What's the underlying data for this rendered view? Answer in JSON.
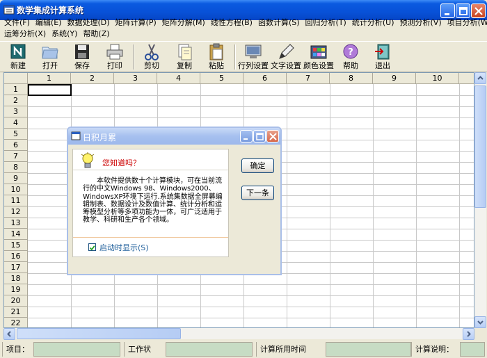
{
  "window": {
    "title": "数学集成计算系统"
  },
  "menu": {
    "row1": [
      "文件(F)",
      "编辑(E)",
      "数据处理(D)",
      "矩阵计算(P)",
      "矩阵分解(M)",
      "线性方程(B)",
      "函数计算(S)",
      "回归分析(T)",
      "统计分析(U)",
      "预测分析(V)",
      "项目分析(W)"
    ],
    "row2": [
      "运筹分析(X)",
      "系统(Y)",
      "帮助(Z)"
    ]
  },
  "toolbar": {
    "new": "新建",
    "open": "打开",
    "save": "保存",
    "print": "打印",
    "cut": "剪切",
    "copy": "复制",
    "paste": "粘贴",
    "rowcol": "行列设置",
    "text": "文字设置",
    "color": "颜色设置",
    "help": "帮助",
    "exit": "退出"
  },
  "grid": {
    "columns": [
      "1",
      "2",
      "3",
      "4",
      "5",
      "6",
      "7",
      "8",
      "9",
      "10"
    ],
    "rows": [
      "1",
      "2",
      "3",
      "4",
      "5",
      "6",
      "7",
      "8",
      "9",
      "10",
      "11",
      "12",
      "13",
      "14",
      "15",
      "16",
      "17",
      "18",
      "19",
      "20",
      "21",
      "22"
    ]
  },
  "status": {
    "item_label": "项目：",
    "state_label": "工作状态：",
    "time_label": "计算所用时间（s）：",
    "note_label": "计算说明："
  },
  "dialog": {
    "title": "日积月累",
    "heading": "您知道吗？",
    "body": "本软件提供数十个计算模块，可在当前流行的中文Windows 98、Windows2000、WindowsXP环境下运行.系统集数据全屏幕编辑制表、数据设计及数值计算、统计分析和运筹模型分析等多项功能为一体，可广泛适用于教学、科研和生产各个领域。",
    "checkbox_label": "启动时显示(S)",
    "checkbox_checked": true,
    "ok_button": "确定",
    "next_button": "下一条"
  }
}
